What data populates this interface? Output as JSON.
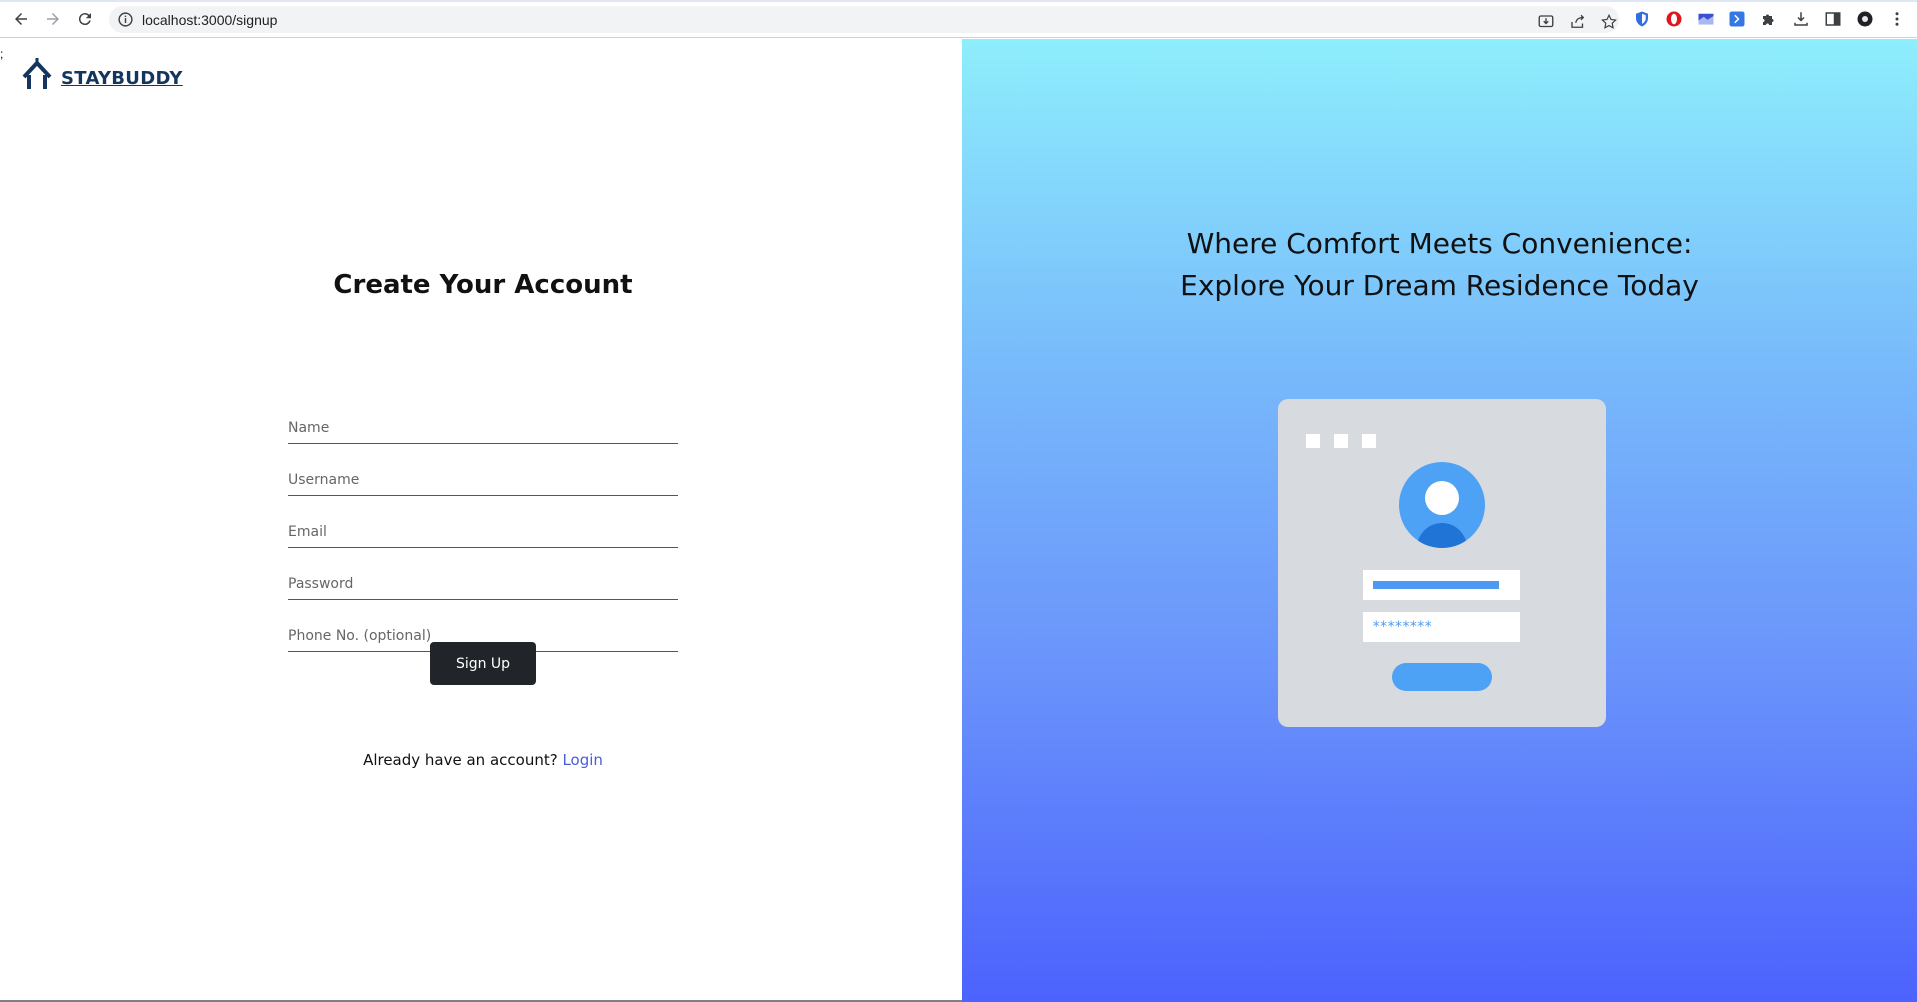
{
  "browser": {
    "url": "localhost:3000/signup"
  },
  "page": {
    "stray_text": ";",
    "brand": {
      "name": "STAYBUDDY"
    },
    "form": {
      "title": "Create Your Account",
      "fields": [
        {
          "name": "name",
          "placeholder": "Name"
        },
        {
          "name": "username",
          "placeholder": "Username"
        },
        {
          "name": "email",
          "placeholder": "Email"
        },
        {
          "name": "password",
          "placeholder": "Password"
        },
        {
          "name": "phone",
          "placeholder": "Phone No. (optional)"
        }
      ],
      "submit_label": "Sign Up",
      "login_prompt": "Already have an account?",
      "login_link": "Login"
    },
    "hero": {
      "tagline_line1": "Where Comfort Meets Convenience:",
      "tagline_line2": "Explore Your Dream Residence Today",
      "illustration_password": "********"
    }
  },
  "colors": {
    "brand": "#14365e",
    "button": "#212529",
    "link": "#4a5dd8",
    "gradient_top": "#8eeefc",
    "gradient_bottom": "#4c62fd"
  }
}
